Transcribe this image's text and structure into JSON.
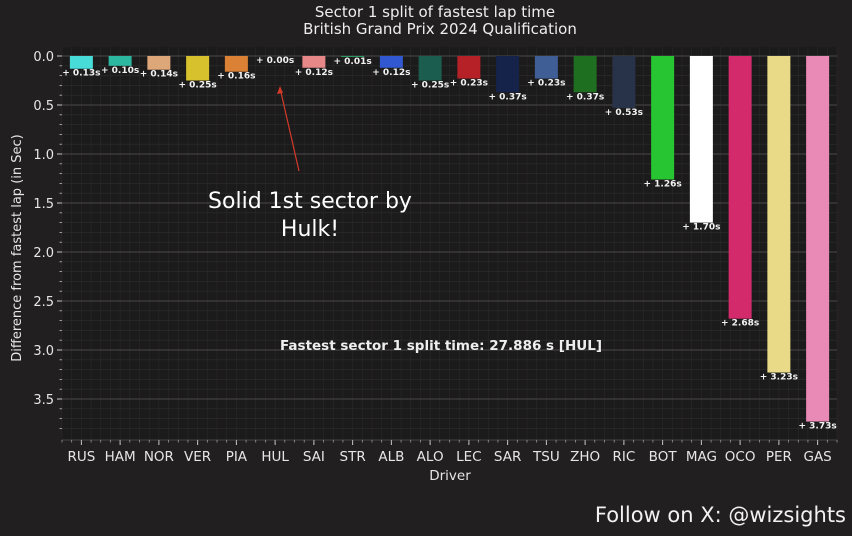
{
  "chart_data": {
    "type": "bar",
    "title": "Sector 1 split of fastest lap time",
    "subtitle": "British Grand Prix 2024 Qualification",
    "xlabel": "Driver",
    "ylabel": "Difference from fastest lap (in Sec)",
    "y_inverted": true,
    "ylim": [
      0,
      3.9
    ],
    "yticks": [
      "0.0",
      "0.5",
      "1.0",
      "1.5",
      "2.0",
      "2.5",
      "3.0",
      "3.5"
    ],
    "grid": true,
    "categories": [
      "RUS",
      "HAM",
      "NOR",
      "VER",
      "PIA",
      "HUL",
      "SAI",
      "STR",
      "ALB",
      "LEC",
      "SAR",
      "TSU",
      "ZHO",
      "RIC",
      "BOT",
      "MAG",
      "OCO",
      "PER",
      "GAS"
    ],
    "values": [
      0.13,
      0.1,
      0.14,
      0.25,
      0.16,
      0.0,
      0.12,
      0.01,
      0.12,
      0.25,
      0.23,
      0.37,
      0.23,
      0.37,
      0.53,
      1.26,
      1.7,
      2.68,
      3.23,
      3.73
    ],
    "bar_values": [
      0.13,
      0.1,
      0.14,
      0.25,
      0.16,
      0.0,
      0.12,
      0.01,
      0.12,
      0.25,
      0.23,
      0.37,
      0.23,
      0.37,
      0.53,
      1.26,
      1.7,
      2.68,
      3.23,
      3.73
    ],
    "bar_labels": [
      "+ 0.13s",
      "+ 0.10s",
      "+ 0.14s",
      "+ 0.25s",
      "+ 0.16s",
      "+ 0.00s",
      "+ 0.12s",
      "+ 0.01s",
      "+ 0.12s",
      "+ 0.25s",
      "+ 0.23s",
      "+ 0.37s",
      "+ 0.23s",
      "+ 0.37s",
      "+ 0.53s",
      "+ 1.26s",
      "+ 1.70s",
      "+ 2.68s",
      "+ 3.23s",
      "+ 3.73s"
    ],
    "xtick_labels": [
      "RUS",
      "HAM",
      "NOR",
      "VER",
      "PIA",
      "HUL",
      "SAI",
      "STR",
      "ALB",
      "ALO",
      "LEC",
      "SAR",
      "TSU",
      "ZHO",
      "RIC",
      "BOT",
      "MAG",
      "OCO",
      "PER",
      "GAS"
    ],
    "colors": [
      "#47dcd8",
      "#2cb8a0",
      "#dda77a",
      "#d7c12c",
      "#da8135",
      "#ffffff",
      "#e58887",
      "#2a9c64",
      "#3158d0",
      "#1b5e4f",
      "#b62127",
      "#15224a",
      "#3f5e96",
      "#1e6f20",
      "#283349",
      "#27c532",
      "#ffffff",
      "#d22a6b",
      "#e8da86",
      "#e98ab6"
    ],
    "annotation": "Solid 1st sector by\nHulk!",
    "center_note": "Fastest sector 1 split time: 27.886 s [HUL]"
  },
  "footer": "Follow on X: @wizsights"
}
